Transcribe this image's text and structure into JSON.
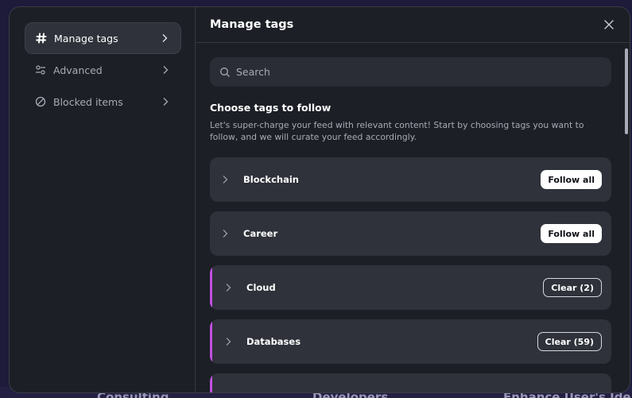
{
  "background": {
    "words": [
      "Consulting",
      "Developers",
      "Enhance User's Ide"
    ]
  },
  "sidebar": {
    "items": [
      {
        "label": "Manage tags",
        "icon": "hash-icon",
        "active": true
      },
      {
        "label": "Advanced",
        "icon": "settings-sliders-icon",
        "active": false
      },
      {
        "label": "Blocked items",
        "icon": "blocked-icon",
        "active": false
      }
    ]
  },
  "header": {
    "title": "Manage tags"
  },
  "search": {
    "placeholder": "Search"
  },
  "section": {
    "title": "Choose tags to follow",
    "description": "Let's super-charge your feed with relevant content! Start by choosing tags you want to follow, and we will curate your feed accordingly."
  },
  "tags": [
    {
      "name": "Blockchain",
      "action": "Follow all",
      "selected": false
    },
    {
      "name": "Career",
      "action": "Follow all",
      "selected": false
    },
    {
      "name": "Cloud",
      "action": "Clear (2)",
      "selected": true
    },
    {
      "name": "Databases",
      "action": "Clear (59)",
      "selected": true
    }
  ],
  "colors": {
    "accent": "#c14fe0",
    "modal_bg": "#1c1f26",
    "row_bg": "#2f323a"
  }
}
